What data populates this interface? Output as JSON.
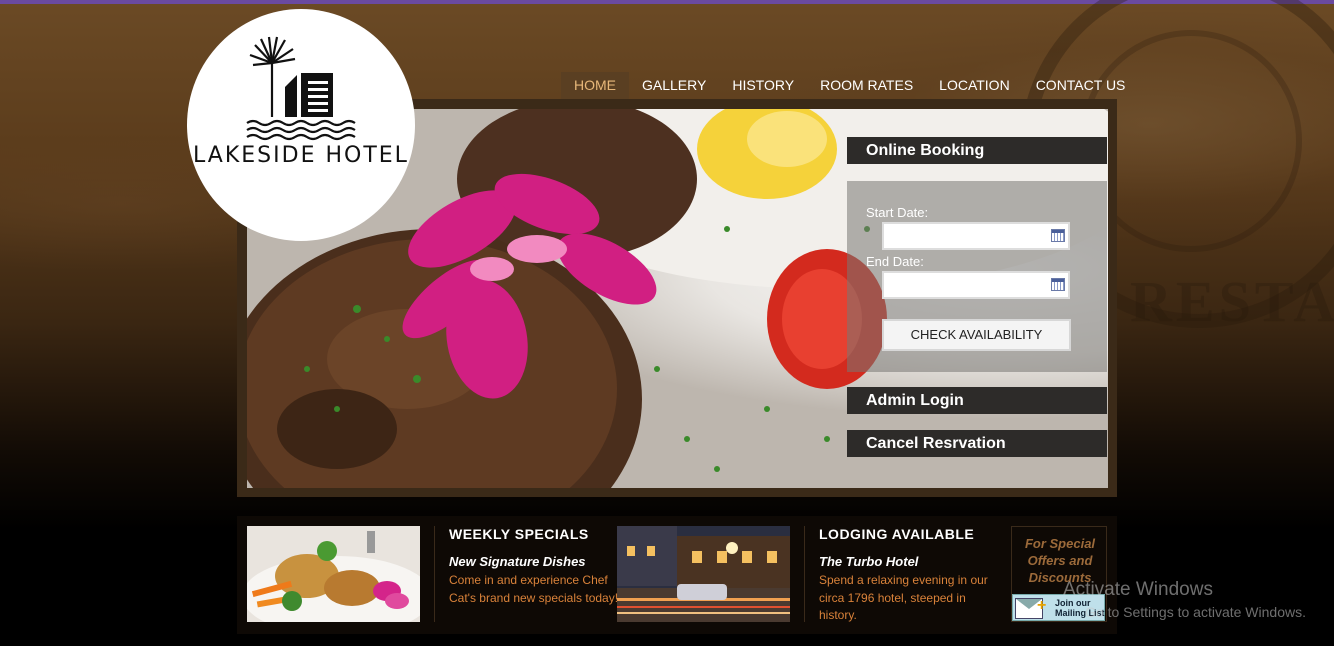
{
  "brand": {
    "name": "LAKESIDE HOTEL"
  },
  "nav": {
    "items": [
      {
        "label": "HOME",
        "active": true
      },
      {
        "label": "GALLERY"
      },
      {
        "label": "HISTORY"
      },
      {
        "label": "ROOM RATES"
      },
      {
        "label": "LOCATION"
      },
      {
        "label": "CONTACT US"
      }
    ]
  },
  "booking": {
    "title": "Online Booking",
    "start_label": "Start Date:",
    "start_value": "",
    "end_label": "End Date:",
    "end_value": "",
    "check_button": "CHECK AVAILABILITY"
  },
  "side_buttons": {
    "admin_login": "Admin Login",
    "cancel_reservation": "Cancel Resrvation"
  },
  "sections": [
    {
      "title": "WEEKLY SPECIALS",
      "subtitle": "New Signature Dishes",
      "body": "Come in and experience Chef Cat's brand new specials today!"
    },
    {
      "title": "LODGING AVAILABLE",
      "subtitle": "The Turbo Hotel",
      "body": "Spend a relaxing evening in our circa 1796 hotel, steeped in history."
    }
  ],
  "offers": {
    "text": "For Special Offers and Discounts",
    "mailing_button": "Join our Mailing List"
  },
  "watermark": {
    "line1": "Activate Windows",
    "line2": "Go to Settings to activate Windows."
  },
  "colors": {
    "nav_active_bg": "#5a3f22",
    "nav_active_text": "#e8b87a",
    "panel_head": "#2d2b29",
    "section_body": "#d9823a",
    "offers_text": "#9c6a3a"
  }
}
